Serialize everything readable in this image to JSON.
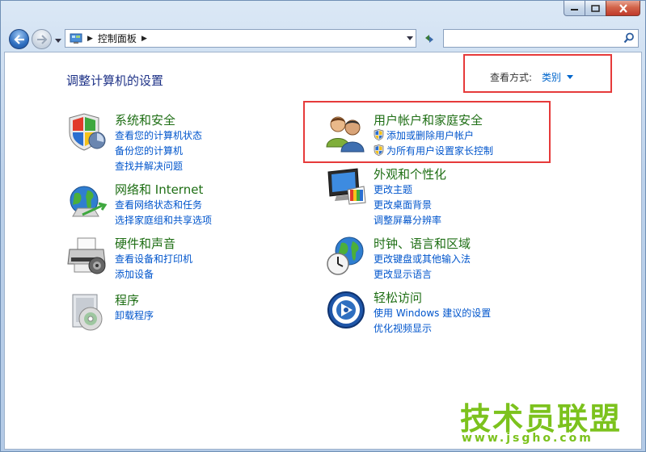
{
  "window": {
    "minimize_glyph": "—",
    "maximize_glyph": "▢",
    "close_glyph": "✕"
  },
  "address": {
    "breadcrumb": "控制面板",
    "search_placeholder": ""
  },
  "content": {
    "heading": "调整计算机的设置",
    "view_by_label": "查看方式:",
    "view_by_value": "类别"
  },
  "categories": {
    "system": {
      "title": "系统和安全",
      "links": [
        "查看您的计算机状态",
        "备份您的计算机",
        "查找并解决问题"
      ]
    },
    "network": {
      "title": "网络和 Internet",
      "links": [
        "查看网络状态和任务",
        "选择家庭组和共享选项"
      ]
    },
    "hardware": {
      "title": "硬件和声音",
      "links": [
        "查看设备和打印机",
        "添加设备"
      ]
    },
    "programs": {
      "title": "程序",
      "links": [
        "卸载程序"
      ]
    },
    "users": {
      "title": "用户帐户和家庭安全",
      "links": [
        "添加或删除用户帐户",
        "为所有用户设置家长控制"
      ]
    },
    "appearance": {
      "title": "外观和个性化",
      "links": [
        "更改主题",
        "更改桌面背景",
        "调整屏幕分辨率"
      ]
    },
    "clock": {
      "title": "时钟、语言和区域",
      "links": [
        "更改键盘或其他输入法",
        "更改显示语言"
      ]
    },
    "ease": {
      "title": "轻松访问",
      "links": [
        "使用 Windows 建议的设置",
        "优化视频显示"
      ]
    }
  },
  "watermark": {
    "text": "技术员联盟",
    "url": "www.jsgho.com"
  },
  "colors": {
    "link": "#0055cc",
    "category_title": "#1e6e14",
    "heading": "#1e3287",
    "highlight": "#e63a3a",
    "watermark": "#7cc21d"
  }
}
